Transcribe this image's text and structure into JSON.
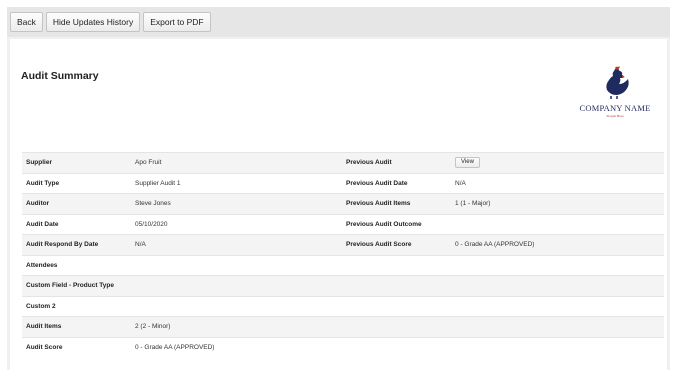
{
  "toolbar": {
    "back_label": "Back",
    "hide_updates_label": "Hide Updates History",
    "export_pdf_label": "Export to PDF"
  },
  "page": {
    "title": "Audit Summary"
  },
  "logo": {
    "name": "COMPANY NAME",
    "tagline": "Slogan Here",
    "icon": "rooster-icon",
    "colors": {
      "body": "#1f2a5e",
      "comb": "#c0392b"
    }
  },
  "summary": {
    "rows": [
      {
        "label": "Supplier",
        "value": "Apo Fruit",
        "label2": "Previous Audit",
        "value2": ""
      },
      {
        "label": "Audit Type",
        "value": "Supplier Audit 1",
        "label2": "Previous Audit Date",
        "value2": "N/A"
      },
      {
        "label": "Auditor",
        "value": "Steve Jones",
        "label2": "Previous Audit Items",
        "value2": "1 (1 - Major)"
      },
      {
        "label": "Audit Date",
        "value": "05/10/2020",
        "label2": "Previous Audit Outcome",
        "value2": ""
      },
      {
        "label": "Audit Respond By Date",
        "value": "N/A",
        "label2": "Previous Audit Score",
        "value2": "0 - Grade AA (APPROVED)"
      },
      {
        "label": "Attendees",
        "value": "",
        "label2": "",
        "value2": ""
      },
      {
        "label": "Custom Field - Product Type",
        "value": "",
        "label2": "",
        "value2": ""
      },
      {
        "label": "Custom 2",
        "value": "",
        "label2": "",
        "value2": ""
      },
      {
        "label": "Audit Items",
        "value": "2 (2 - Minor)",
        "label2": "",
        "value2": ""
      },
      {
        "label": "Audit Score",
        "value": "0 - Grade AA (APPROVED)",
        "label2": "",
        "value2": ""
      }
    ],
    "view_button_label": "View"
  }
}
